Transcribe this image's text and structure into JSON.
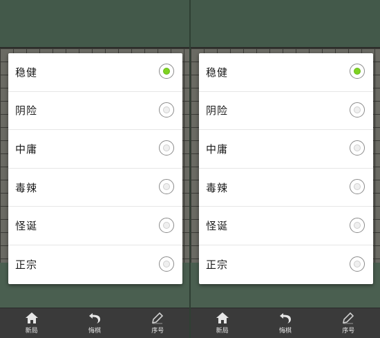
{
  "options": [
    {
      "label": "稳健",
      "selected": true
    },
    {
      "label": "阴险",
      "selected": false
    },
    {
      "label": "中庸",
      "selected": false
    },
    {
      "label": "毒辣",
      "selected": false
    },
    {
      "label": "怪诞",
      "selected": false
    },
    {
      "label": "正宗",
      "selected": false
    }
  ],
  "toolbar": {
    "new_game_label": "新局",
    "undo_label": "悔棋",
    "sequence_label": "序号",
    "new_game_icon": "home-icon",
    "undo_icon": "undo-arrow-icon",
    "sequence_icon": "pencil-icon"
  },
  "colors": {
    "selected_radio": "#7ed321",
    "toolbar_bg": "#3a3a3a",
    "background_green": "#43594a"
  }
}
